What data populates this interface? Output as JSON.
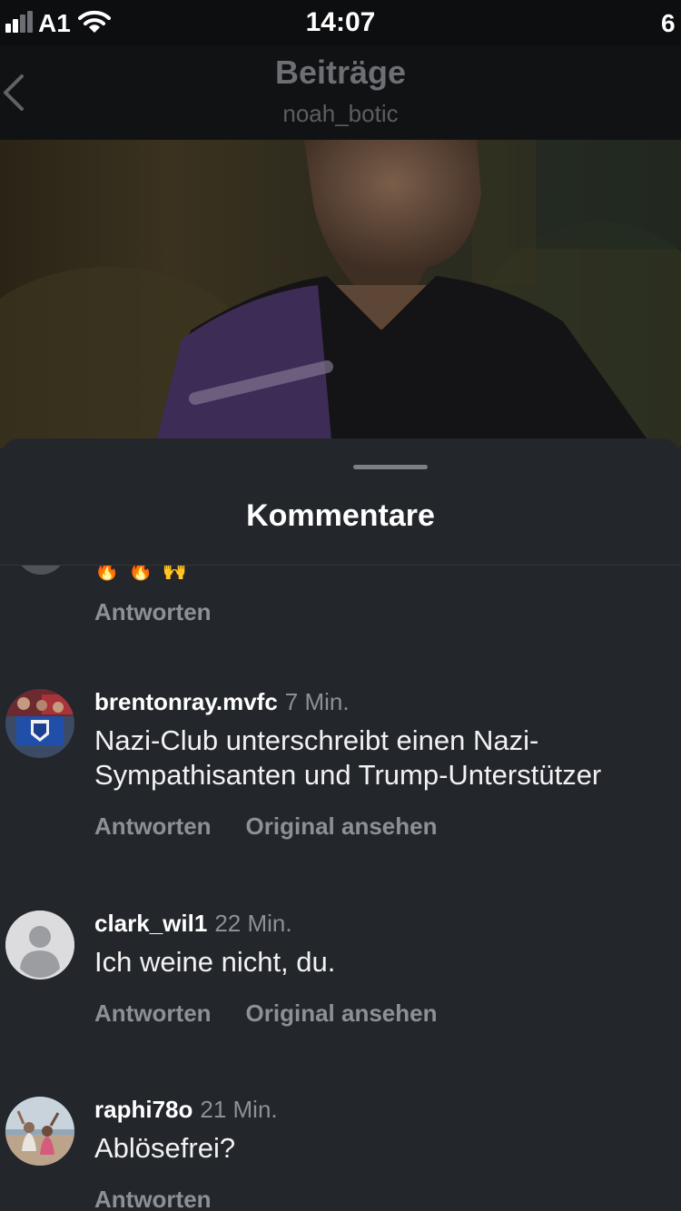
{
  "status_bar": {
    "carrier": "A1",
    "time": "14:07",
    "battery": "6"
  },
  "header": {
    "title": "Beiträge",
    "subtitle": "noah_botic"
  },
  "sheet": {
    "title": "Kommentare"
  },
  "partial_comment": {
    "emoji": "🔥🔥🙌",
    "reply_label": "Antworten"
  },
  "comments": [
    {
      "username": "brentonray.mvfc",
      "time": "7 Min.",
      "text": "Nazi-Club unterschreibt einen Nazi-Sympathisanten und Trump-Unterstützer",
      "reply_label": "Antworten",
      "original_label": "Original ansehen"
    },
    {
      "username": "clark_wil1",
      "time": "22 Min.",
      "text": "Ich weine nicht, du.",
      "reply_label": "Antworten",
      "original_label": "Original ansehen"
    },
    {
      "username": "raphi78o",
      "time": "21 Min.",
      "text": "Ablösefrei?",
      "reply_label": "Antworten"
    }
  ]
}
